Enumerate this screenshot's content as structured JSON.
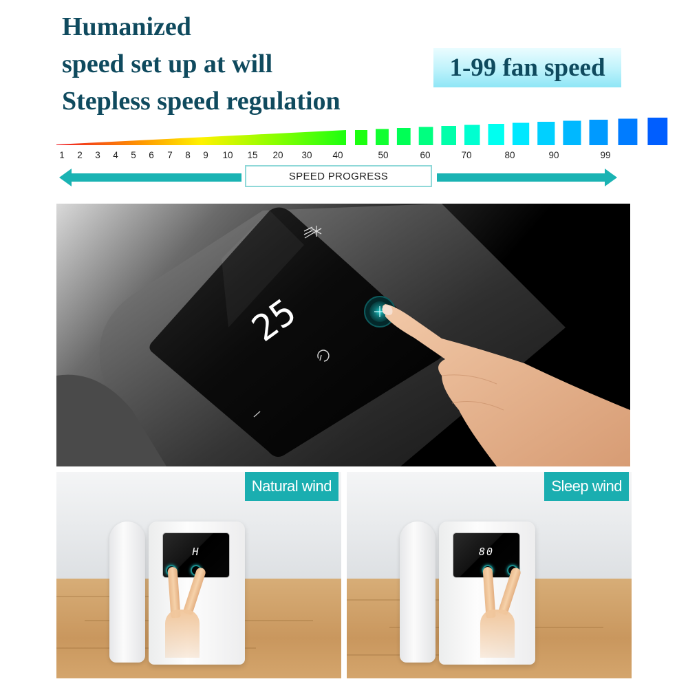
{
  "headline": {
    "line1": "Humanized",
    "line2": "speed set up at will",
    "line3": "Stepless speed regulation"
  },
  "badge": {
    "text": "1-99 fan speed"
  },
  "speed_scale": {
    "ticks": [
      "1",
      "2",
      "3",
      "4",
      "5",
      "6",
      "7",
      "8",
      "9",
      "10",
      "15",
      "20",
      "30",
      "40",
      "50",
      "60",
      "70",
      "80",
      "90",
      "99"
    ],
    "label": "SPEED PROGRESS",
    "min": 1,
    "max": 99,
    "gradient_colors": [
      "#ee1c25",
      "#ff8a00",
      "#fff200",
      "#7cff00",
      "#00ff3c",
      "#00ffd0",
      "#00c8ff",
      "#0066ff"
    ],
    "arrow_color": "#1ab3b3"
  },
  "control_panel": {
    "display_value": "25",
    "mode_icon": "snowflake-wind-icon",
    "button_icon": "fan-speed-button-icon",
    "power_icon": "power-icon",
    "accent_color": "#1aaeb0"
  },
  "modes": [
    {
      "label": "Natural wind",
      "display_value": "H"
    },
    {
      "label": "Sleep wind",
      "display_value": "80"
    }
  ]
}
